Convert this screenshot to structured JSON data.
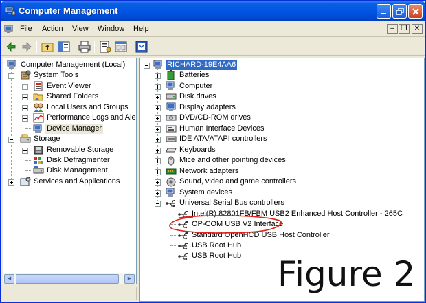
{
  "window": {
    "title": "Computer Management"
  },
  "menubar": {
    "items": [
      {
        "key": "F",
        "rest": "ile"
      },
      {
        "key": "A",
        "rest": "ction"
      },
      {
        "key": "V",
        "rest": "iew"
      },
      {
        "key": "W",
        "rest": "indow"
      },
      {
        "key": "H",
        "rest": "elp"
      }
    ]
  },
  "toolbar": {
    "icons": [
      "back-icon",
      "forward-icon",
      "up-folder-icon",
      "show-hide-tree-icon",
      "print-icon",
      "properties-icon",
      "export-list-icon",
      "help-icon"
    ]
  },
  "left_tree": {
    "root": "Computer Management (Local)",
    "system_tools": "System Tools",
    "event_viewer": "Event Viewer",
    "shared_folders": "Shared Folders",
    "local_users": "Local Users and Groups",
    "performance": "Performance Logs and Alerts",
    "device_manager": "Device Manager",
    "storage": "Storage",
    "removable_storage": "Removable Storage",
    "disk_defrag": "Disk Defragmenter",
    "disk_mgmt": "Disk Management",
    "services": "Services and Applications"
  },
  "right_tree": {
    "root": "RICHARD-19E4AA6",
    "batteries": "Batteries",
    "computer": "Computer",
    "disk_drives": "Disk drives",
    "display": "Display adapters",
    "dvd": "DVD/CD-ROM drives",
    "hid": "Human Interface Devices",
    "ide": "IDE ATA/ATAPI controllers",
    "keyboards": "Keyboards",
    "mice": "Mice and other pointing devices",
    "network": "Network adapters",
    "sound": "Sound, video and game controllers",
    "system_devices": "System devices",
    "usb": "Universal Serial Bus controllers",
    "usb_intel": "Intel(R) 82801FB/FBM USB2 Enhanced Host Controller - 265C",
    "usb_opcom": "OP-COM USB V2 Interface",
    "usb_standard": "Standard OpenHCD USB Host Controller",
    "usb_hub1": "USB Root Hub",
    "usb_hub2": "USB Root Hub"
  },
  "annotation": {
    "figure_label": "Figure 2",
    "circle_color": "#e0201a"
  },
  "colors": {
    "title_blue": "#0055e5",
    "selection": "#316ac5",
    "close_red": "#c94322"
  }
}
